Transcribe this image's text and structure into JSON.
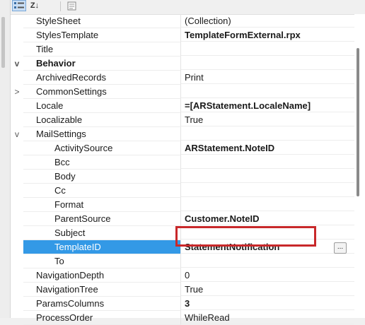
{
  "toolbar": {
    "categorized_icon": "categorized-icon",
    "alphabetical_icon": "alphabetical-icon",
    "alphabetical_label": "Z↓",
    "property_pages_icon": "property-pages-icon"
  },
  "rows": {
    "stylesheet": {
      "name": "StyleSheet",
      "value": "(Collection)"
    },
    "styles_template": {
      "name": "StylesTemplate",
      "value": "TemplateFormExternal.rpx"
    },
    "title": {
      "name": "Title",
      "value": ""
    },
    "behavior": {
      "name": "Behavior",
      "toggle": "v"
    },
    "archived_records": {
      "name": "ArchivedRecords",
      "value": "Print"
    },
    "common_settings": {
      "name": "CommonSettings",
      "value": "",
      "toggle": ">"
    },
    "locale": {
      "name": "Locale",
      "value": "=[ARStatement.LocaleName]"
    },
    "localizable": {
      "name": "Localizable",
      "value": "True"
    },
    "mail_settings": {
      "name": "MailSettings",
      "value": "",
      "toggle": "v"
    },
    "activity_source": {
      "name": "ActivitySource",
      "value": "ARStatement.NoteID"
    },
    "bcc": {
      "name": "Bcc",
      "value": ""
    },
    "body": {
      "name": "Body",
      "value": ""
    },
    "cc": {
      "name": "Cc",
      "value": ""
    },
    "format": {
      "name": "Format",
      "value": ""
    },
    "parent_source": {
      "name": "ParentSource",
      "value": "Customer.NoteID"
    },
    "subject": {
      "name": "Subject",
      "value": ""
    },
    "template_id": {
      "name": "TemplateID",
      "value": "StatementNotification",
      "button": "..."
    },
    "to": {
      "name": "To",
      "value": ""
    },
    "navigation_depth": {
      "name": "NavigationDepth",
      "value": "0"
    },
    "navigation_tree": {
      "name": "NavigationTree",
      "value": "True"
    },
    "params_columns": {
      "name": "ParamsColumns",
      "value": "3"
    },
    "process_order": {
      "name": "ProcessOrder",
      "value": "WhileRead"
    }
  },
  "colors": {
    "selection": "#3399e6",
    "highlight_border": "#c8282a"
  }
}
